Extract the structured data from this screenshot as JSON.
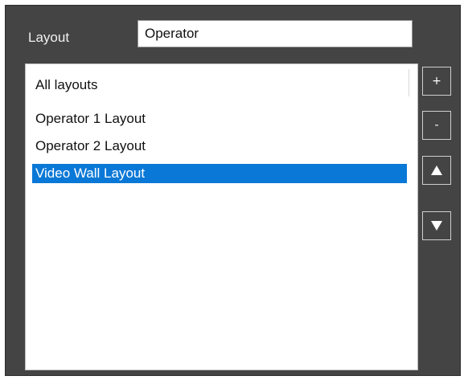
{
  "layout_field": {
    "label": "Layout",
    "value": "Operator"
  },
  "layout_list": {
    "items": [
      {
        "label": "All layouts",
        "selected": false
      },
      {
        "label": "Operator 1 Layout",
        "selected": false
      },
      {
        "label": "Operator 2 Layout",
        "selected": false
      },
      {
        "label": "Video Wall Layout",
        "selected": true
      }
    ]
  },
  "side_buttons": {
    "add_label": "+",
    "remove_label": "-",
    "move_up_icon": "triangle-up-icon",
    "move_down_icon": "triangle-down-icon"
  },
  "colors": {
    "panel_background": "#444444",
    "selection": "#0a78d7",
    "list_background": "#ffffff"
  }
}
